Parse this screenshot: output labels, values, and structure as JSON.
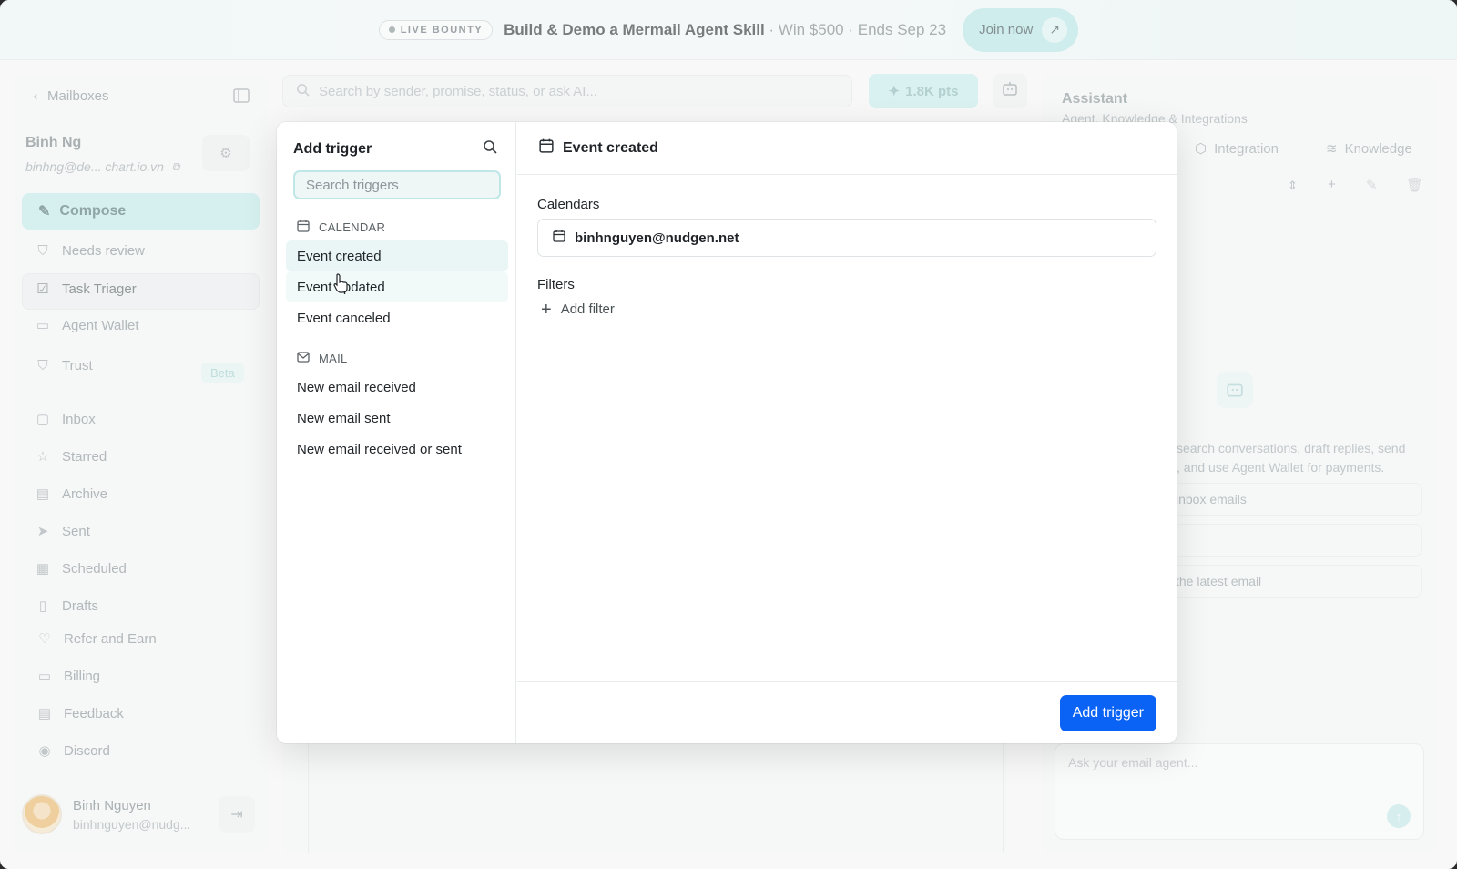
{
  "banner": {
    "badge": "LIVE BOUNTY",
    "headline": "Build & Demo a Mermail Agent Skill",
    "detail": " · Win $500 · Ends Sep 23",
    "cta": "Join now"
  },
  "sidebar": {
    "back_label": "Mailboxes",
    "account_name": "Binh Ng",
    "account_email": "binhng@de... chart.io.vn",
    "compose_label": "Compose",
    "items": [
      {
        "label": "Needs review"
      },
      {
        "label": "Task Triager"
      },
      {
        "label": "Agent Wallet"
      },
      {
        "label": "Trust"
      },
      {
        "label": "Inbox"
      },
      {
        "label": "Starred"
      },
      {
        "label": "Archive"
      },
      {
        "label": "Sent"
      },
      {
        "label": "Scheduled"
      },
      {
        "label": "Drafts"
      },
      {
        "label": "Refer and Earn"
      },
      {
        "label": "Billing"
      },
      {
        "label": "Feedback"
      },
      {
        "label": "Discord"
      }
    ],
    "beta_badge": "Beta",
    "user_name": "Binh Nguyen",
    "user_email": "binhnguyen@nudg..."
  },
  "search": {
    "placeholder": "Search by sender, promise, status, or ask AI..."
  },
  "points": {
    "label": "1.8K pts"
  },
  "assistant": {
    "title": "Assistant",
    "subtitle": "Agent, Knowledge & Integrations",
    "tab_integration": "Integration",
    "tab_knowledge": "Knowledge",
    "description_line1": "search conversations, draft replies, send",
    "description_line2": ", and use Agent Wallet for payments.",
    "suggestion_1": "inbox emails",
    "suggestion_2": "",
    "suggestion_3": "the latest email",
    "input_placeholder": "Ask your email agent..."
  },
  "modal": {
    "title": "Add trigger",
    "search_placeholder": "Search triggers",
    "sections": [
      {
        "name": "CALENDAR",
        "items": [
          {
            "label": "Event created"
          },
          {
            "label": "Event updated"
          },
          {
            "label": "Event canceled"
          }
        ]
      },
      {
        "name": "MAIL",
        "items": [
          {
            "label": "New email received"
          },
          {
            "label": "New email sent"
          },
          {
            "label": "New email received or sent"
          }
        ]
      }
    ],
    "detail_title": "Event created",
    "calendars_label": "Calendars",
    "calendar_account": "binhnguyen@nudgen.net",
    "filters_label": "Filters",
    "add_filter_label": "Add filter",
    "submit_label": "Add trigger"
  },
  "colors": {
    "primary_button": "#0b63f6",
    "accent_teal": "#c4ecec",
    "selected_item": "#eaf6f6"
  }
}
